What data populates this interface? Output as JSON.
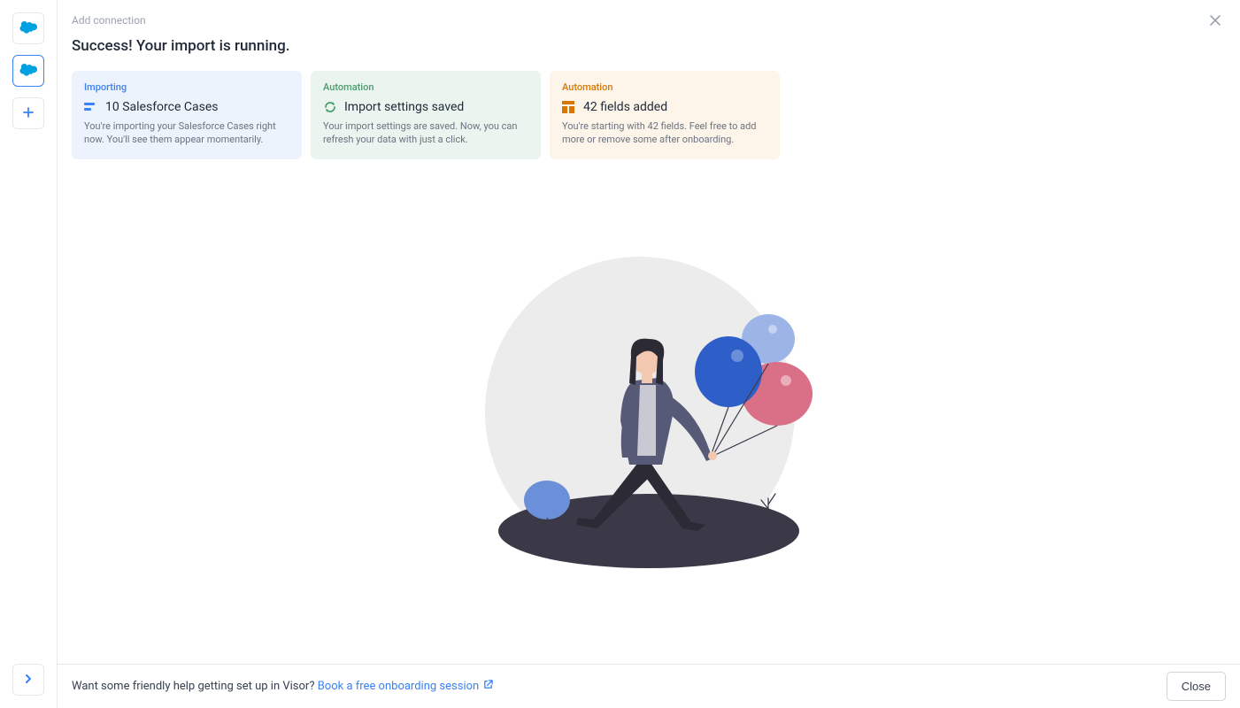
{
  "header": {
    "label": "Add connection",
    "title": "Success! Your import is running."
  },
  "cards": [
    {
      "tag": "Importing",
      "title": "10 Salesforce Cases",
      "desc": "You're importing your Salesforce Cases right now. You'll see them appear momentarily."
    },
    {
      "tag": "Automation",
      "title": "Import settings saved",
      "desc": "Your import settings are saved. Now, you can refresh your data with just a click."
    },
    {
      "tag": "Automation",
      "title": "42 fields added",
      "desc": "You're starting with 42 fields. Feel free to add more or remove some after onboarding."
    }
  ],
  "footer": {
    "text": "Want some friendly help getting set up in Visor? ",
    "link": "Book a free onboarding session",
    "close": "Close"
  },
  "sidebar": {
    "icons": [
      "salesforce-icon",
      "salesforce-icon",
      "plus-icon"
    ],
    "expand": "chevron-right-icon"
  }
}
